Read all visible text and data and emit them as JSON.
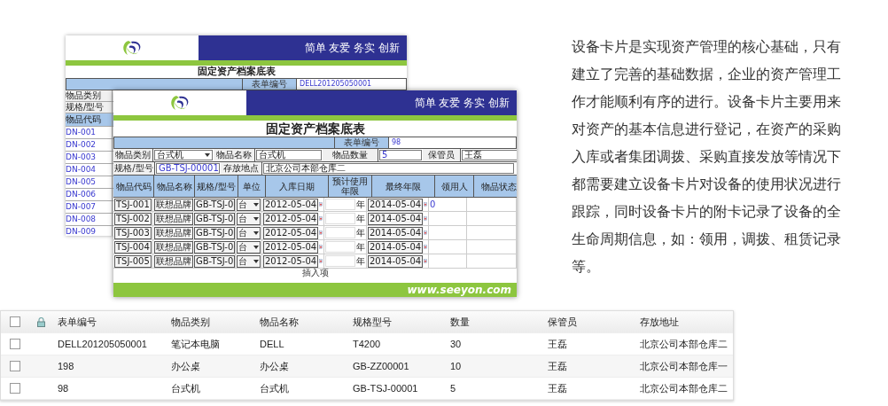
{
  "back_form": {
    "slogan": "简单 友爱 务实 创新",
    "title": "固定资产档案底表",
    "form_number_label": "表单编号",
    "form_number": "DELL201205050001",
    "labels": [
      "物品类别",
      "规格/型号"
    ],
    "code_header": "物品代码",
    "codes": [
      "DN-001",
      "DN-002",
      "DN-003",
      "DN-004",
      "DN-005",
      "DN-006",
      "DN-007",
      "DN-008",
      "DN-009"
    ]
  },
  "front_form": {
    "slogan": "简单 友爱 务实 创新",
    "title": "固定资产档案底表",
    "form_number_label": "表单编号",
    "form_number": "98",
    "field_rows": [
      [
        {
          "label": "物品类别",
          "value": "台式机",
          "kind": "select"
        },
        {
          "label": "物品名称",
          "value": "台式机",
          "kind": "input"
        },
        {
          "label": "物品数量",
          "value": "5",
          "kind": "input"
        },
        {
          "label": "保管员",
          "value": "王磊",
          "kind": "input"
        }
      ],
      [
        {
          "label": "规格/型号",
          "value": "GB-TSJ-00001",
          "kind": "input"
        },
        {
          "label": "存放地点",
          "value": "北京公司本部仓库二",
          "kind": "input"
        }
      ]
    ],
    "columns": [
      "物品代码",
      "物品名称",
      "规格/型号",
      "单位",
      "入库日期",
      "预计使用年限",
      "最终年限",
      "领用人",
      "物品状态"
    ],
    "rows": [
      {
        "code": "TSJ-001",
        "name": "联想品牌",
        "spec": "GB-TSJ-0",
        "unit": "台",
        "in_date": "2012-05-04",
        "year_unit": "年",
        "end_date": "2014-05-04",
        "recipient": "0"
      },
      {
        "code": "TSJ-002",
        "name": "联想品牌",
        "spec": "GB-TSJ-0",
        "unit": "台",
        "in_date": "2012-05-04",
        "year_unit": "年",
        "end_date": "2014-05-04"
      },
      {
        "code": "TSJ-003",
        "name": "联想品牌",
        "spec": "GB-TSJ-0",
        "unit": "台",
        "in_date": "2012-05-04",
        "year_unit": "年",
        "end_date": "2014-05-04"
      },
      {
        "code": "TSJ-004",
        "name": "联想品牌",
        "spec": "GB-TSJ-0",
        "unit": "台",
        "in_date": "2012-05-04",
        "year_unit": "年",
        "end_date": "2014-05-04"
      },
      {
        "code": "TSJ-005",
        "name": "联想品牌",
        "spec": "GB-TSJ-0",
        "unit": "台",
        "in_date": "2012-05-04",
        "year_unit": "年",
        "end_date": "2014-05-04"
      }
    ],
    "insert_label": "插入项",
    "website": "www.seeyon.com"
  },
  "description": "设备卡片是实现资产管理的核心基础，只有建立了完善的基础数据，企业的资产管理工作才能顺利有序的进行。设备卡片主要用来对资产的基本信息进行登记，在资产的采购入库或者集团调拨、采购直接发放等情况下都需要建立设备卡片对设备的使用状况进行跟踪，同时设备卡片的附卡记录了设备的全生命周期信息，如：领用，调拨、租赁记录等。",
  "table": {
    "header_checked": false,
    "columns": [
      "表单编号",
      "物品类别",
      "物品名称",
      "规格型号",
      "数量",
      "保管员",
      "存放地址"
    ],
    "rows": [
      {
        "checked": false,
        "cells": [
          "DELL201205050001",
          "笔记本电脑",
          "DELL",
          "T4200",
          "30",
          "王磊",
          "北京公司本部仓库二"
        ]
      },
      {
        "checked": false,
        "cells": [
          "198",
          "办公桌",
          "办公桌",
          "GB-ZZ00001",
          "10",
          "王磊",
          "北京公司本部仓库一"
        ]
      },
      {
        "checked": false,
        "cells": [
          "98",
          "台式机",
          "台式机",
          "GB-TSJ-00001",
          "5",
          "王磊",
          "北京公司本部仓库二"
        ]
      }
    ]
  }
}
